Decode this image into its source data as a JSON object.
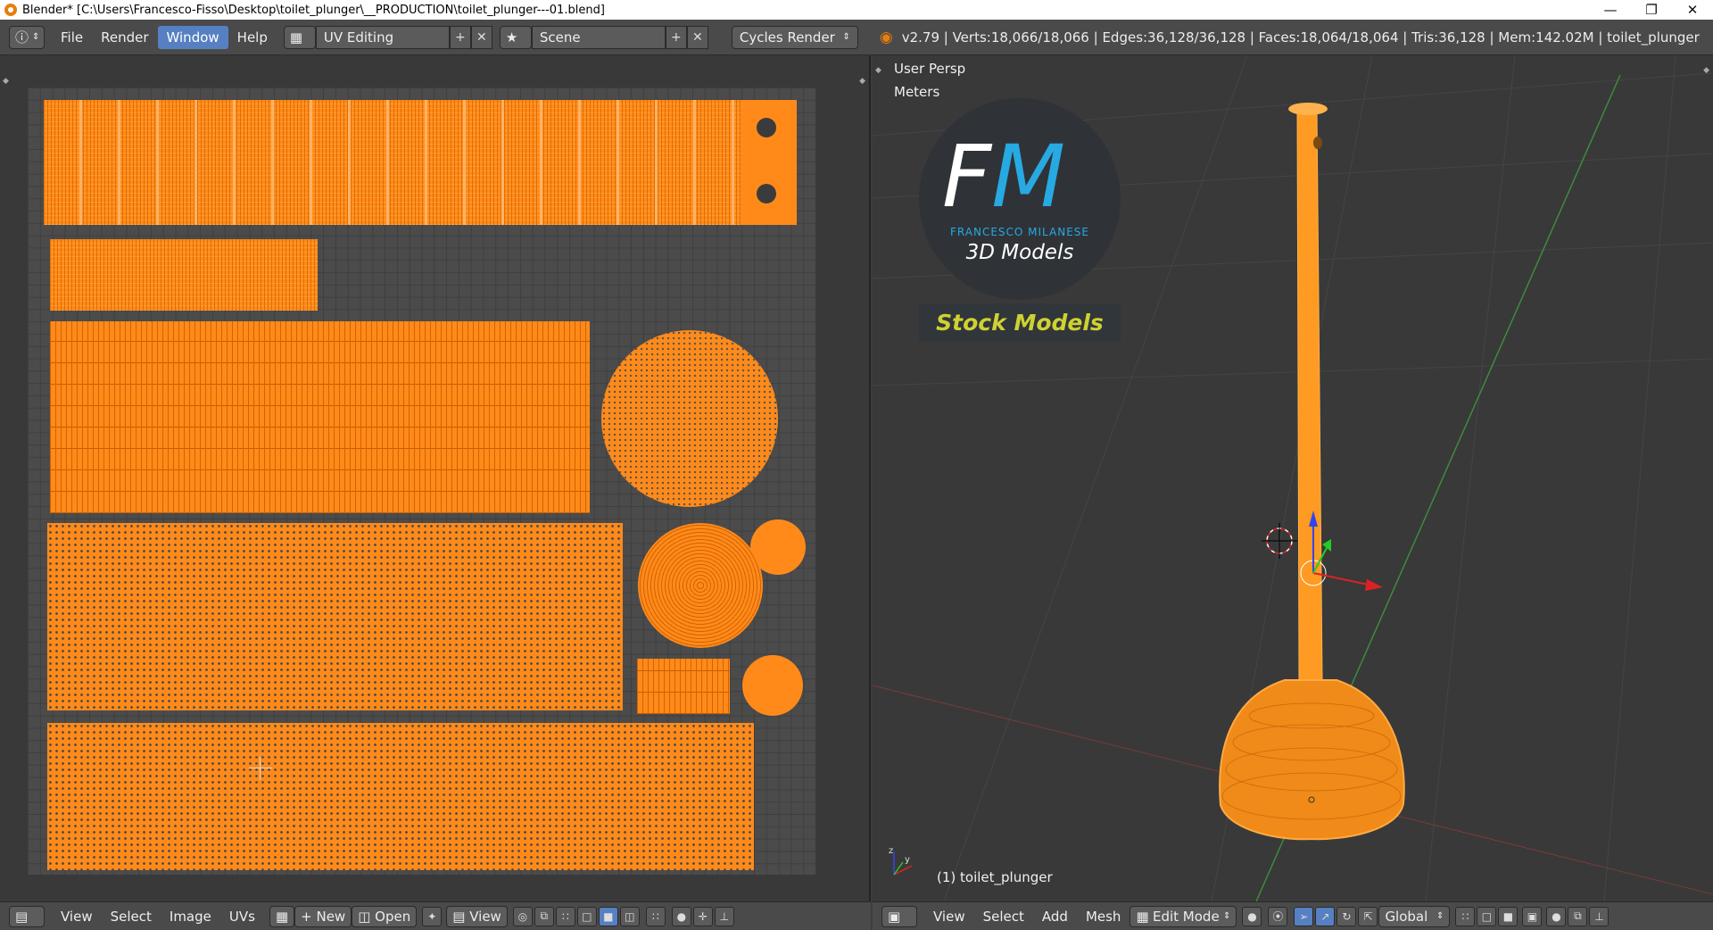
{
  "window": {
    "title": "Blender* [C:\\Users\\Francesco-Fisso\\Desktop\\toilet_plunger\\__PRODUCTION\\toilet_plunger---01.blend]",
    "minimize_icon": "minimize-icon",
    "restore_icon": "restore-icon",
    "close_icon": "close-icon"
  },
  "topbar": {
    "menus": [
      "File",
      "Render",
      "Window",
      "Help"
    ],
    "active_menu": "Window",
    "screen_layout": "UV Editing",
    "scene": "Scene",
    "render_engine": "Cycles Render",
    "stats": "v2.79 | Verts:18,066/18,066 | Edges:36,128/36,128 | Faces:18,064/18,064 | Tris:36,128 | Mem:142.02M | toilet_plunger"
  },
  "uv_editor": {
    "bottom_menus": [
      "View",
      "Select",
      "Image",
      "UVs"
    ],
    "new_label": "New",
    "open_label": "Open",
    "view_label": "View"
  },
  "viewport": {
    "view_name": "User Persp",
    "units": "Meters",
    "object_label": "(1) toilet_plunger",
    "logo": {
      "letters_f": "F",
      "letters_m": "M",
      "name": "FRANCESCO MILANESE",
      "subtitle": "3D Models",
      "stock": "Stock Models"
    },
    "bottom_menus": [
      "View",
      "Select",
      "Add",
      "Mesh"
    ],
    "mode": "Edit Mode",
    "orientation": "Global"
  },
  "colors": {
    "accent_orange": "#ff8a1a",
    "selection_blue": "#5680c2",
    "logo_blue": "#27a9e1",
    "stock_yellow": "#cfd132"
  }
}
